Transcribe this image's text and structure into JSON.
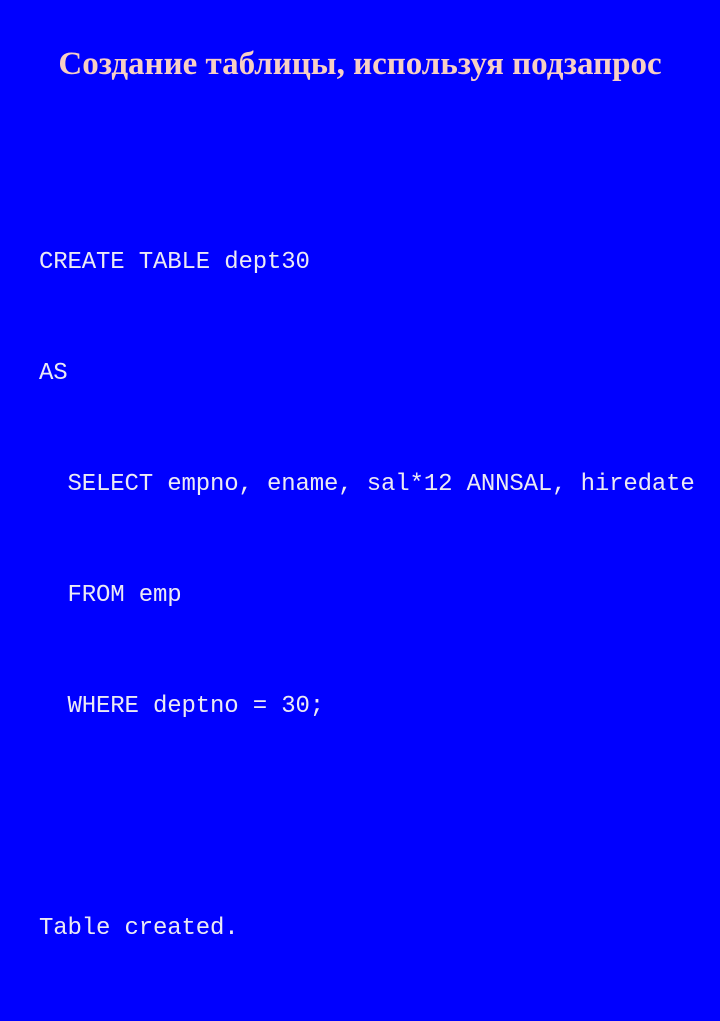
{
  "slide": {
    "background_color": "#0000FF",
    "title": "Создание таблицы, используя подзапрос",
    "title_color": "#F7CFC4",
    "code_color": "#ECEAF4",
    "code_lines": [
      "CREATE TABLE dept30",
      "AS",
      "  SELECT empno, ename, sal*12 ANNSAL, hiredate",
      "  FROM emp",
      "  WHERE deptno = 30;",
      "",
      "Table created."
    ]
  }
}
